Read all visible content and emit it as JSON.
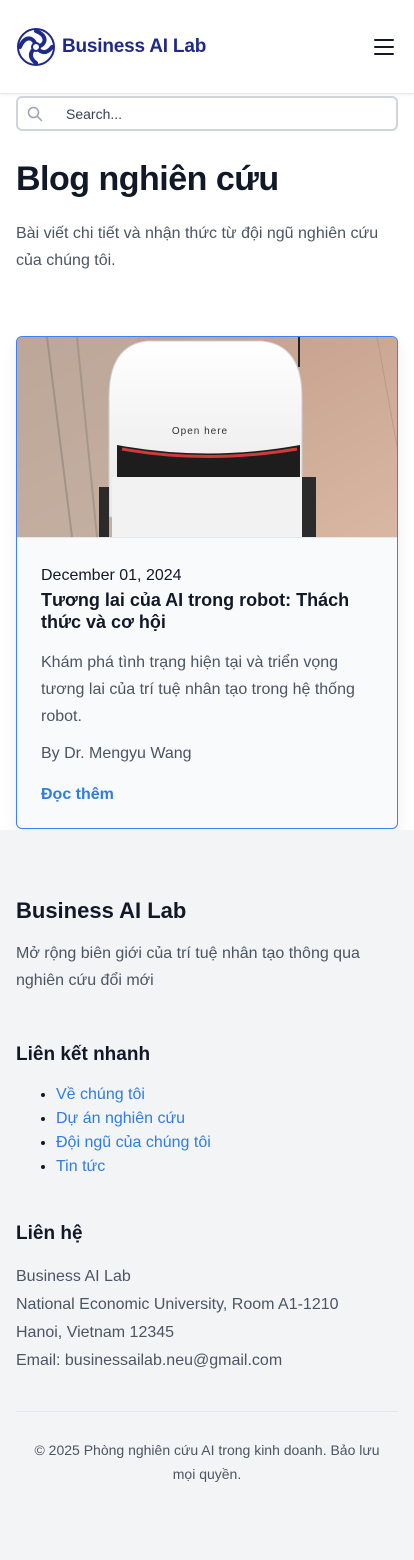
{
  "header": {
    "brand_name": "Business AI Lab",
    "logo_icon": "swirl-logo-icon",
    "menu_icon": "hamburger-menu-icon"
  },
  "search": {
    "placeholder": "Search...",
    "value": ""
  },
  "hero": {
    "title": "Blog nghiên cứu",
    "subtitle": "Bài viết chi tiết và nhận thức từ đội ngũ nghiên cứu của chúng tôi."
  },
  "posts": [
    {
      "image_text": "Open here",
      "date": "December 01, 2024",
      "title": "Tương lai của AI trong robot: Thách thức và cơ hội",
      "excerpt": "Khám phá tình trạng hiện tại và triển vọng tương lai của trí tuệ nhân tạo trong hệ thống robot.",
      "author": "By Dr. Mengyu Wang",
      "read_more": "Đọc thêm"
    }
  ],
  "footer": {
    "brand": "Business AI Lab",
    "tagline": "Mở rộng biên giới của trí tuệ nhân tạo thông qua nghiên cứu đổi mới",
    "quick_links_heading": "Liên kết nhanh",
    "quick_links": [
      "Về chúng tôi",
      "Dự án nghiên cứu",
      "Đội ngũ của chúng tôi",
      "Tin tức"
    ],
    "contact_heading": "Liên hệ",
    "contact_lines": [
      "Business AI Lab",
      "National Economic University, Room A1-1210",
      "Hanoi, Vietnam 12345",
      "Email: businessailab.neu@gmail.com"
    ],
    "copyright": "© 2025 Phòng nghiên cứu AI trong kinh doanh. Bảo lưu mọi quyền."
  },
  "colors": {
    "brand": "#1e2a8a",
    "link": "#2f7de1",
    "card_border": "#3b82f6"
  }
}
